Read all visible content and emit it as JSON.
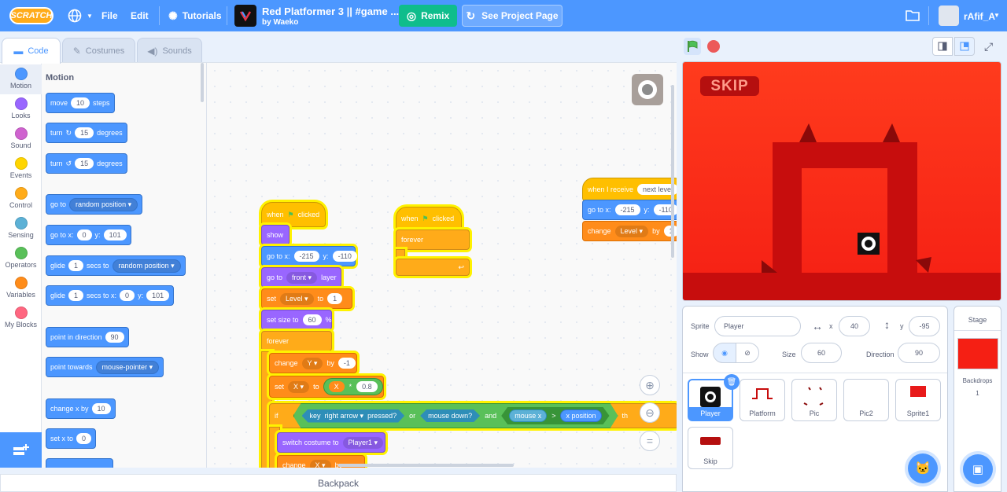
{
  "menubar": {
    "logo": "SCRATCH",
    "file": "File",
    "edit": "Edit",
    "tutorials": "Tutorials",
    "project_title": "Red Platformer 3 || #game ...",
    "project_by": "by Waeko",
    "remix": "Remix",
    "see_project_page": "See Project Page",
    "username": "rAfif_A"
  },
  "tabs": {
    "code": "Code",
    "costumes": "Costumes",
    "sounds": "Sounds"
  },
  "categories": [
    {
      "label": "Motion",
      "color": "#4c97ff"
    },
    {
      "label": "Looks",
      "color": "#9966ff"
    },
    {
      "label": "Sound",
      "color": "#cf63cf"
    },
    {
      "label": "Events",
      "color": "#ffd500"
    },
    {
      "label": "Control",
      "color": "#ffab19"
    },
    {
      "label": "Sensing",
      "color": "#5cb1d6"
    },
    {
      "label": "Operators",
      "color": "#59c059"
    },
    {
      "label": "Variables",
      "color": "#ff8c1a"
    },
    {
      "label": "My Blocks",
      "color": "#ff6680"
    }
  ],
  "palette": {
    "title": "Motion",
    "move": {
      "a": "move",
      "v": "10",
      "b": "steps"
    },
    "turn_right": {
      "a": "turn",
      "v": "15",
      "b": "degrees"
    },
    "turn_left": {
      "a": "turn",
      "v": "15",
      "b": "degrees"
    },
    "goto": {
      "a": "go to",
      "d": "random position"
    },
    "goto_xy": {
      "a": "go to x:",
      "x": "0",
      "b": "y:",
      "y": "101"
    },
    "glide": {
      "a": "glide",
      "v": "1",
      "b": "secs to",
      "d": "random position"
    },
    "glide_xy": {
      "a": "glide",
      "v": "1",
      "b": "secs to x:",
      "x": "0",
      "c": "y:",
      "y": "101"
    },
    "point_dir": {
      "a": "point in direction",
      "v": "90"
    },
    "point_towards": {
      "a": "point towards",
      "d": "mouse-pointer"
    },
    "change_x": {
      "a": "change x by",
      "v": "10"
    },
    "set_x": {
      "a": "set x to",
      "v": "0"
    }
  },
  "script1": {
    "hat": "when",
    "hat_b": "clicked",
    "show": "show",
    "goto": {
      "a": "go to x:",
      "x": "-215",
      "b": "y:",
      "y": "-110"
    },
    "layer": {
      "a": "go to",
      "d": "front",
      "b": "layer"
    },
    "set_level": {
      "a": "set",
      "d": "Level",
      "b": "to",
      "v": "1"
    },
    "set_size": {
      "a": "set size to",
      "v": "60",
      "b": "%"
    },
    "forever": "forever",
    "change_y": {
      "a": "change",
      "d": "Y",
      "b": "by",
      "v": "-1"
    },
    "set_x": {
      "a": "set",
      "d": "X",
      "b": "to",
      "op_l": "X",
      "op": "*",
      "v": "0.8"
    },
    "if": {
      "a": "if",
      "key": "key",
      "key_d": "right arrow",
      "pressed": "pressed?",
      "or": "or",
      "mouse_down": "mouse down?",
      "and": "and",
      "mx": "mouse x",
      "gt": ">",
      "xpos": "x position",
      "then": "th"
    },
    "switch": {
      "a": "switch costume to",
      "d": "Player1"
    },
    "change_x": {
      "a": "change",
      "d": "X",
      "b": "by"
    }
  },
  "script2": {
    "hat": "when",
    "hat_b": "clicked",
    "forever": "forever"
  },
  "script3": {
    "hat": "when I receive",
    "hat_d": "next level",
    "goto": {
      "a": "go to x:",
      "x": "-215",
      "b": "y:",
      "y": "-110"
    },
    "change": {
      "a": "change",
      "d": "Level",
      "b": "by",
      "v": "1"
    }
  },
  "backpack": "Backpack",
  "stage": {
    "skip": "SKIP"
  },
  "sprite_info": {
    "sprite_label": "Sprite",
    "sprite_name": "Player",
    "x_label": "x",
    "x": "40",
    "y_label": "y",
    "y": "-95",
    "show_label": "Show",
    "size_label": "Size",
    "size": "60",
    "direction_label": "Direction",
    "direction": "90"
  },
  "sprites": [
    "Player",
    "Platform",
    "Pic",
    "Pic2",
    "Sprite1",
    "Skip"
  ],
  "stage_pane": {
    "title": "Stage",
    "backdrops": "Backdrops",
    "count": "1"
  }
}
